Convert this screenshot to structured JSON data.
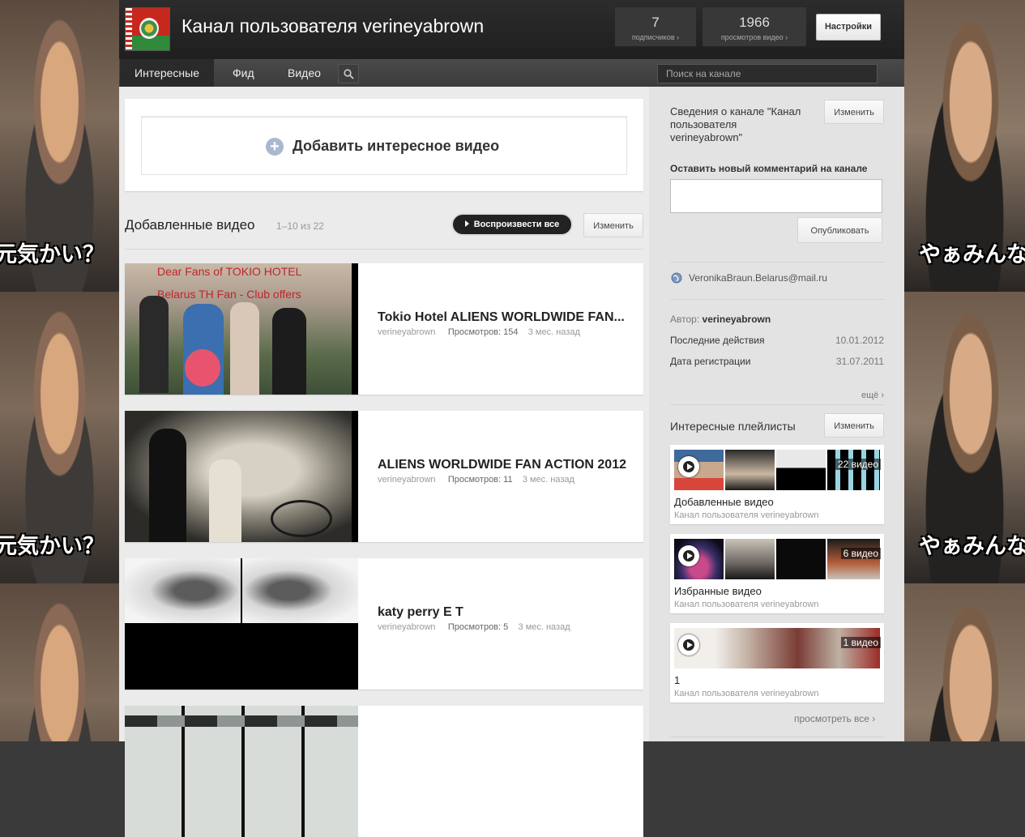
{
  "background": {
    "caption_left": "元気かい？",
    "caption_right": "やぁみんな"
  },
  "header": {
    "title": "Канал пользователя verineyabrown",
    "subscribers": {
      "count": "7",
      "label": "подписчиков ›"
    },
    "views": {
      "count": "1966",
      "label": "просмотров видео ›"
    },
    "settings_label": "Настройки"
  },
  "nav": {
    "tabs": [
      "Интересные",
      "Фид",
      "Видео"
    ],
    "search_placeholder": "Поиск на канале"
  },
  "main": {
    "add_video_label": "Добавить интересное видео",
    "section_title": "Добавленные видео",
    "section_count": "1–10 из 22",
    "play_all_label": "Воспроизвести все",
    "edit_label": "Изменить",
    "videos": [
      {
        "title": "Tokio Hotel ALIENS WORLDWIDE FAN...",
        "author": "verineyabrown",
        "views_label": "Просмотров:",
        "views": "154",
        "age": "3 мес. назад",
        "thumb_text_1": "Dear Fans of TOKIO HOTEL",
        "thumb_text_2": "Belarus TH Fan - Club offers"
      },
      {
        "title": "ALIENS WORLDWIDE FAN ACTION 2012",
        "author": "verineyabrown",
        "views_label": "Просмотров:",
        "views": "11",
        "age": "3 мес. назад"
      },
      {
        "title": "katy perry E T",
        "author": "verineyabrown",
        "views_label": "Просмотров:",
        "views": "5",
        "age": "3 мес. назад"
      }
    ]
  },
  "sidebar": {
    "info_title": "Сведения о канале \"Канал пользователя verineyabrown\"",
    "info_title_lines": [
      "Сведения о канале \"Канал",
      "пользователя",
      "verineyabrown\""
    ],
    "edit_label": "Изменить",
    "comment_label": "Оставить новый комментарий на канале",
    "publish_label": "Опубликовать",
    "email": "VeronikaBraun.Belarus@mail.ru",
    "author_label": "Автор:",
    "author": "verineyabrown",
    "last_activity_label": "Последние действия",
    "last_activity": "10.01.2012",
    "registered_label": "Дата регистрации",
    "registered": "31.07.2011",
    "more_label": "ещё",
    "playlists_title": "Интересные плейлисты",
    "playlists": [
      {
        "count": "22 видео",
        "name": "Добавленные видео",
        "owner": "Канал пользователя verineyabrown"
      },
      {
        "count": "6 видео",
        "name": "Избранные видео",
        "owner": "Канал пользователя verineyabrown"
      },
      {
        "count": "1 видео",
        "name": "1",
        "owner": "Канал пользователя verineyabrown"
      }
    ],
    "see_all_label": "просмотреть все ›"
  }
}
